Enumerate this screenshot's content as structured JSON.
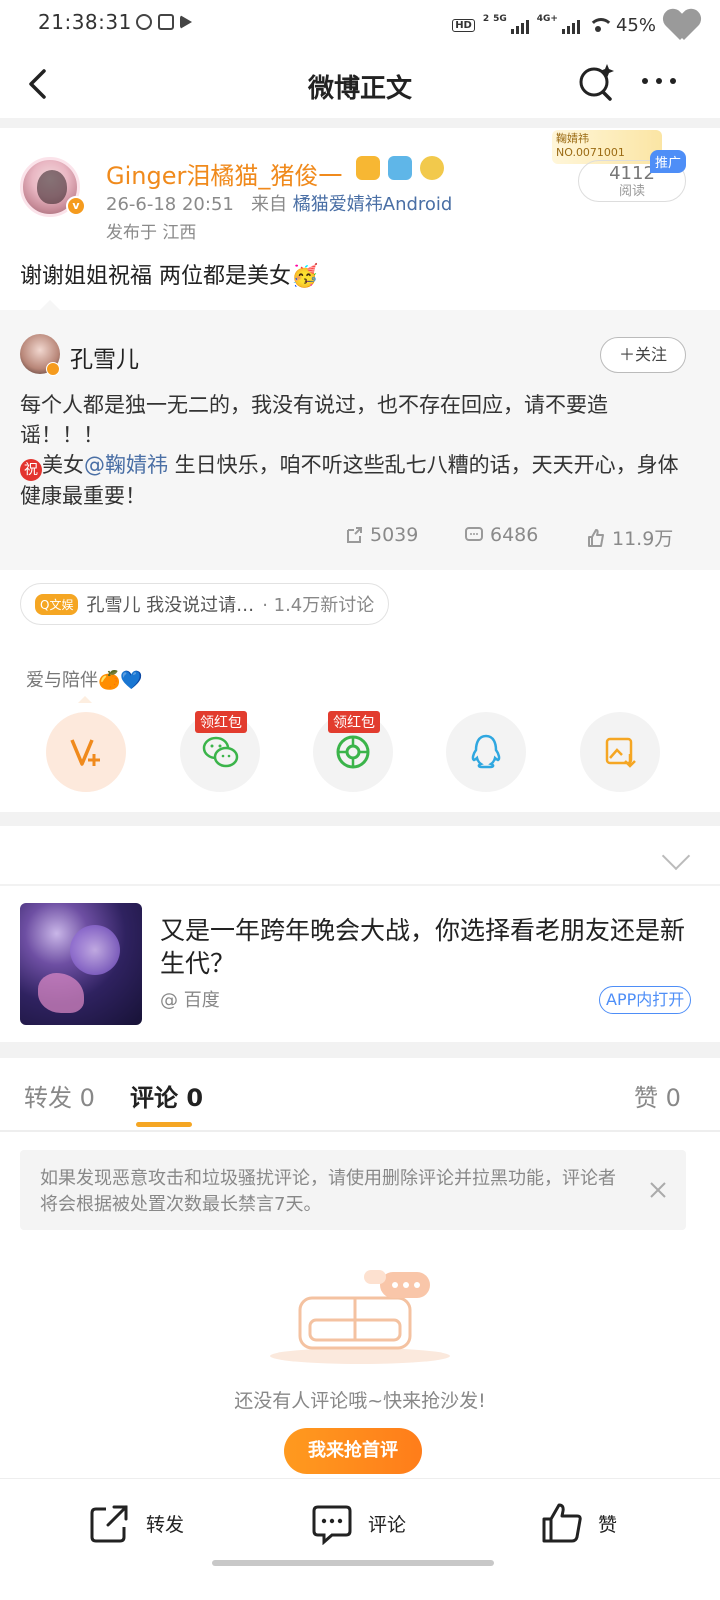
{
  "status_bar": {
    "time": "21:38:31",
    "hd_label": "HD",
    "sim2": "2",
    "net5g": "5G",
    "net4g": "4G+",
    "battery": "45%"
  },
  "nav": {
    "title": "微博正文"
  },
  "post": {
    "author": "Ginger泪橘猫_猪俊一",
    "time": "26-6-18 20:51",
    "source_prefix": "来自",
    "source": "橘猫爱婧祎Android",
    "location": "发布于 江西",
    "text": "谢谢姐姐祝福 两位都是美女🥳",
    "reads": "4112",
    "reads_label": "阅读",
    "promo_tag": "推广",
    "fan_card_name": "鞠婧祎",
    "fan_card_no": "NO.0071001"
  },
  "retweet": {
    "author": "孔雪儿",
    "follow_label": "＋关注",
    "text_line1": "每个人都是独一无二的，我没有说过，也不存在回应，请不要造谣！！！",
    "zhu": "祝",
    "text_pre_at": "美女",
    "at_user": "@鞠婧祎",
    "text_post_at": " 生日快乐，咱不听这些乱七八糟的话，天天开心，身体健康最重要！",
    "reposts": "5039",
    "comments": "6486",
    "likes": "11.9万"
  },
  "topic": {
    "tag": "Q文娱",
    "text": "孔雪儿 我没说过请…",
    "sub": "· 1.4万新讨论"
  },
  "hobby_text": "爱与陪伴🍊💙",
  "share": {
    "badge1": "领红包",
    "badge2": "领红包"
  },
  "ad": {
    "title": "又是一年跨年晚会大战，你选择看老朋友还是新生代？",
    "source": "@ 百度",
    "open_label": "APP内打开"
  },
  "tabs": {
    "repost": "转发 0",
    "comment": "评论 0",
    "like": "赞 0"
  },
  "notice": "如果发现恶意攻击和垃圾骚扰评论，请使用删除评论并拉黑功能，评论者将会根据被处置次数最长禁言7天。",
  "empty": {
    "text": "还没有人评论哦~快来抢沙发!",
    "button": "我来抢首评"
  },
  "bottom_bar": {
    "repost": "转发",
    "comment": "评论",
    "like": "赞"
  },
  "colors": {
    "accent_orange": "#f08a1c",
    "link_blue": "#4a6fa5",
    "tab_underline": "#f5a623"
  }
}
